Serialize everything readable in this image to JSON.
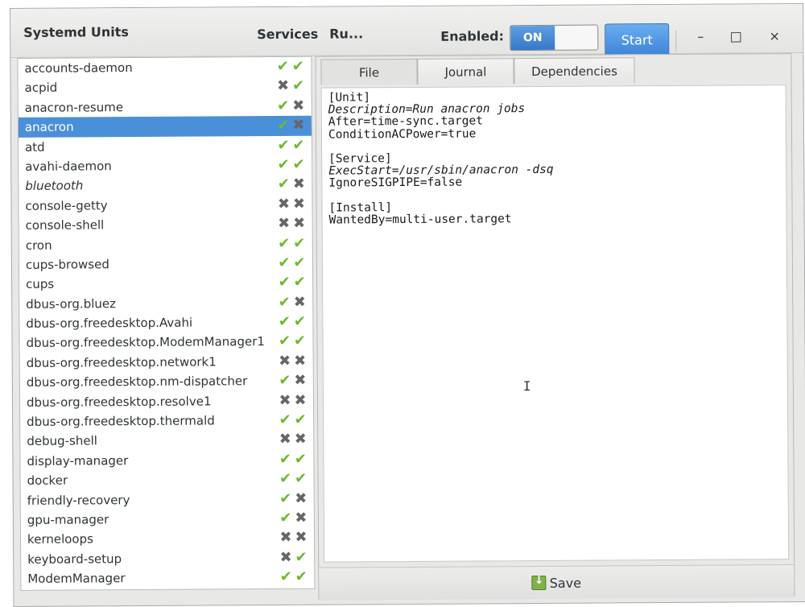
{
  "window": {
    "title": "Systemd Units",
    "header_tabs": [
      "Services",
      "Ru..."
    ],
    "enabled_label": "Enabled:",
    "toggle_on_label": "ON",
    "start_label": "Start",
    "minimize_glyph": "–",
    "maximize_glyph": "□",
    "close_glyph": "×"
  },
  "icons": {
    "enabled": "check-icon",
    "disabled": "cross-icon"
  },
  "colors": {
    "selection": "#4a90d9",
    "check": "#6db833",
    "cross": "#666666",
    "accent": "#3f84d8"
  },
  "units": [
    {
      "name": "accounts-daemon",
      "enabled": true,
      "running": true
    },
    {
      "name": "acpid",
      "enabled": false,
      "running": true
    },
    {
      "name": "anacron-resume",
      "enabled": true,
      "running": false
    },
    {
      "name": "anacron",
      "enabled": true,
      "running": false,
      "selected": true
    },
    {
      "name": "atd",
      "enabled": true,
      "running": true
    },
    {
      "name": "avahi-daemon",
      "enabled": true,
      "running": true
    },
    {
      "name": "bluetooth",
      "enabled": true,
      "running": false,
      "italic": true
    },
    {
      "name": "console-getty",
      "enabled": false,
      "running": false
    },
    {
      "name": "console-shell",
      "enabled": false,
      "running": false
    },
    {
      "name": "cron",
      "enabled": true,
      "running": true
    },
    {
      "name": "cups-browsed",
      "enabled": true,
      "running": true
    },
    {
      "name": "cups",
      "enabled": true,
      "running": true
    },
    {
      "name": "dbus-org.bluez",
      "enabled": true,
      "running": false
    },
    {
      "name": "dbus-org.freedesktop.Avahi",
      "enabled": true,
      "running": true
    },
    {
      "name": "dbus-org.freedesktop.ModemManager1",
      "enabled": true,
      "running": true
    },
    {
      "name": "dbus-org.freedesktop.network1",
      "enabled": false,
      "running": false
    },
    {
      "name": "dbus-org.freedesktop.nm-dispatcher",
      "enabled": true,
      "running": false
    },
    {
      "name": "dbus-org.freedesktop.resolve1",
      "enabled": false,
      "running": false
    },
    {
      "name": "dbus-org.freedesktop.thermald",
      "enabled": true,
      "running": true
    },
    {
      "name": "debug-shell",
      "enabled": false,
      "running": false
    },
    {
      "name": "display-manager",
      "enabled": true,
      "running": true
    },
    {
      "name": "docker",
      "enabled": true,
      "running": true
    },
    {
      "name": "friendly-recovery",
      "enabled": true,
      "running": false
    },
    {
      "name": "gpu-manager",
      "enabled": true,
      "running": false
    },
    {
      "name": "kerneloops",
      "enabled": false,
      "running": false
    },
    {
      "name": "keyboard-setup",
      "enabled": false,
      "running": true
    },
    {
      "name": "ModemManager",
      "enabled": true,
      "running": true
    }
  ],
  "tabs": [
    "File",
    "Journal",
    "Dependencies"
  ],
  "file": {
    "lines": [
      "[Unit]",
      "Description=Run anacron jobs",
      "After=time-sync.target",
      "ConditionACPower=true",
      "",
      "[Service]",
      "ExecStart=/usr/sbin/anacron -dsq",
      "IgnoreSIGPIPE=false",
      "",
      "[Install]",
      "WantedBy=multi-user.target"
    ]
  },
  "save_label": "Save"
}
